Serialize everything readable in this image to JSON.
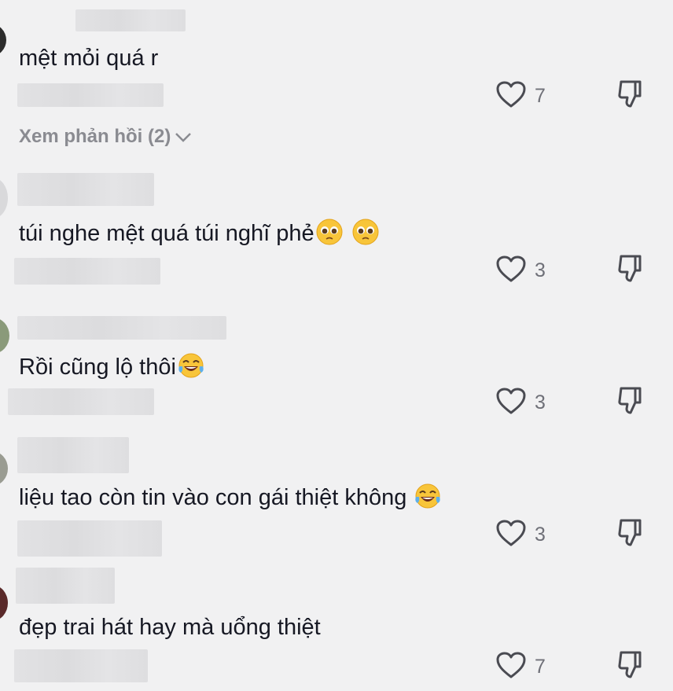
{
  "comments": [
    {
      "text": "mệt mỏi quá r",
      "likes": "7",
      "emoji": []
    },
    {
      "text": "túi nghe mệt quá túi nghĩ phẻ",
      "likes": "3",
      "emoji": [
        "pleading-face-icon",
        "pleading-face-icon"
      ]
    },
    {
      "text": "Rồi cũng lộ thôi",
      "likes": "3",
      "emoji": [
        "tears-of-joy-icon"
      ]
    },
    {
      "text": "liệu tao còn tin vào con gái thiệt không",
      "likes": "3",
      "emoji": [
        "tears-of-joy-icon"
      ]
    },
    {
      "text": "đẹp trai hát hay mà uổng thiệt",
      "likes": "7",
      "emoji": []
    }
  ],
  "view_replies_label": "Xem phản hồi (2)",
  "colors": {
    "background": "#f1f1f2",
    "text": "#161823",
    "muted": "#8a8b91",
    "icon": "#4a4b52"
  }
}
